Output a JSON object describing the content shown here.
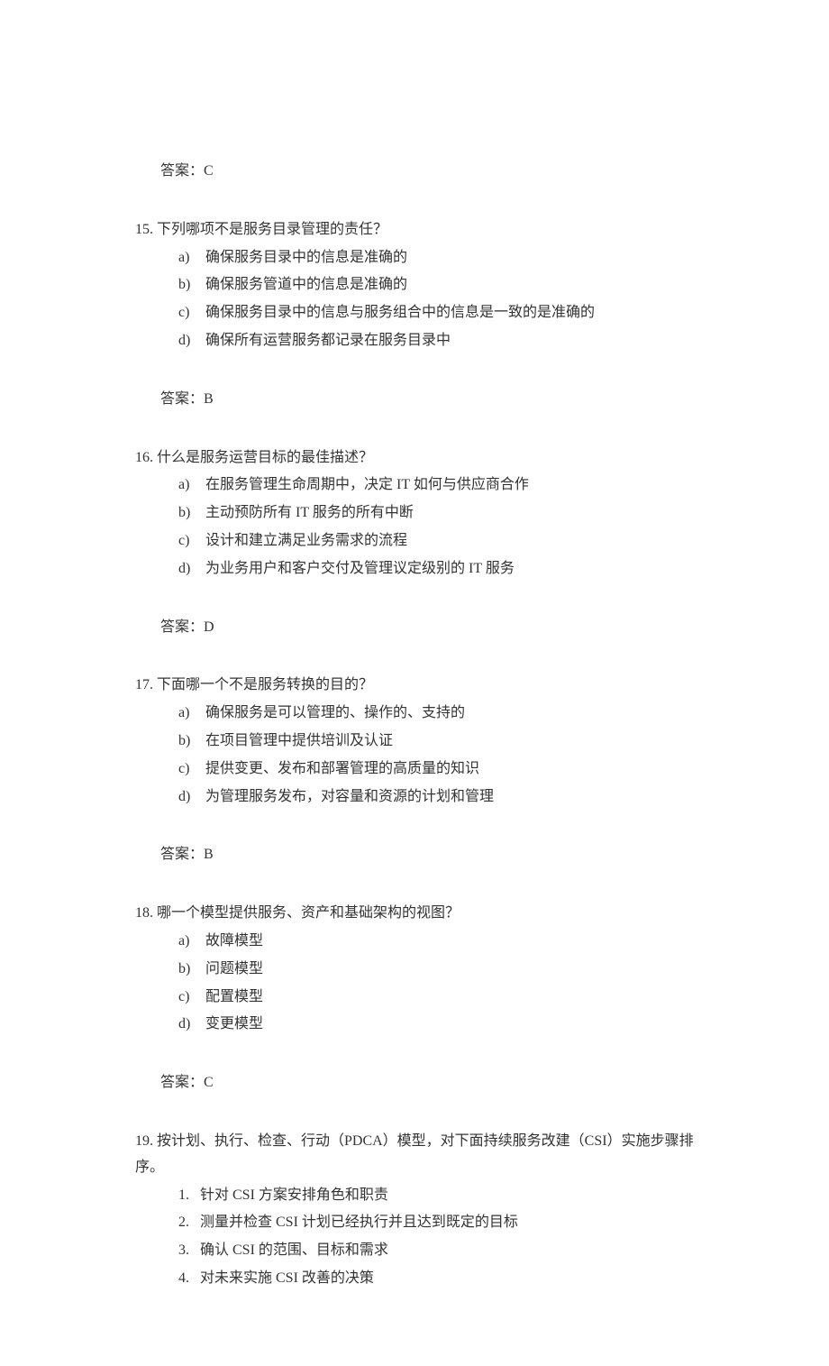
{
  "answer_prefix": "答案：",
  "answer_14": "C",
  "q15": {
    "num": "15.",
    "text": "下列哪项不是服务目录管理的责任？",
    "options": [
      {
        "letter": "a)",
        "text": "确保服务目录中的信息是准确的"
      },
      {
        "letter": "b)",
        "text": "确保服务管道中的信息是准确的"
      },
      {
        "letter": "c)",
        "text": "确保服务目录中的信息与服务组合中的信息是一致的是准确的"
      },
      {
        "letter": "d)",
        "text": "确保所有运营服务都记录在服务目录中"
      }
    ],
    "answer": "B"
  },
  "q16": {
    "num": "16.",
    "text": "什么是服务运营目标的最佳描述？",
    "options": [
      {
        "letter": "a)",
        "text": "在服务管理生命周期中，决定 IT 如何与供应商合作"
      },
      {
        "letter": "b)",
        "text": "主动预防所有 IT 服务的所有中断"
      },
      {
        "letter": "c)",
        "text": "设计和建立满足业务需求的流程"
      },
      {
        "letter": "d)",
        "text": "为业务用户和客户交付及管理议定级别的 IT 服务"
      }
    ],
    "answer": "D"
  },
  "q17": {
    "num": "17.",
    "text": "下面哪一个不是服务转换的目的？",
    "options": [
      {
        "letter": "a)",
        "text": "确保服务是可以管理的、操作的、支持的"
      },
      {
        "letter": "b)",
        "text": "在项目管理中提供培训及认证"
      },
      {
        "letter": "c)",
        "text": "提供变更、发布和部署管理的高质量的知识"
      },
      {
        "letter": "d)",
        "text": "为管理服务发布，对容量和资源的计划和管理"
      }
    ],
    "answer": "B"
  },
  "q18": {
    "num": "18.",
    "text": "哪一个模型提供服务、资产和基础架构的视图？",
    "options": [
      {
        "letter": "a)",
        "text": "故障模型"
      },
      {
        "letter": "b)",
        "text": "问题模型"
      },
      {
        "letter": "c)",
        "text": "配置模型"
      },
      {
        "letter": "d)",
        "text": "变更模型"
      }
    ],
    "answer": "C"
  },
  "q19": {
    "num": "19.",
    "text": "按计划、执行、检查、行动（PDCA）模型，对下面持续服务改建（CSI）实施步骤排序。",
    "items": [
      {
        "num": "1.",
        "text": "针对 CSI 方案安排角色和职责"
      },
      {
        "num": "2.",
        "text": "测量并检查 CSI 计划已经执行并且达到既定的目标"
      },
      {
        "num": "3.",
        "text": "确认 CSI 的范围、目标和需求"
      },
      {
        "num": "4.",
        "text": "对未来实施 CSI 改善的决策"
      }
    ]
  }
}
